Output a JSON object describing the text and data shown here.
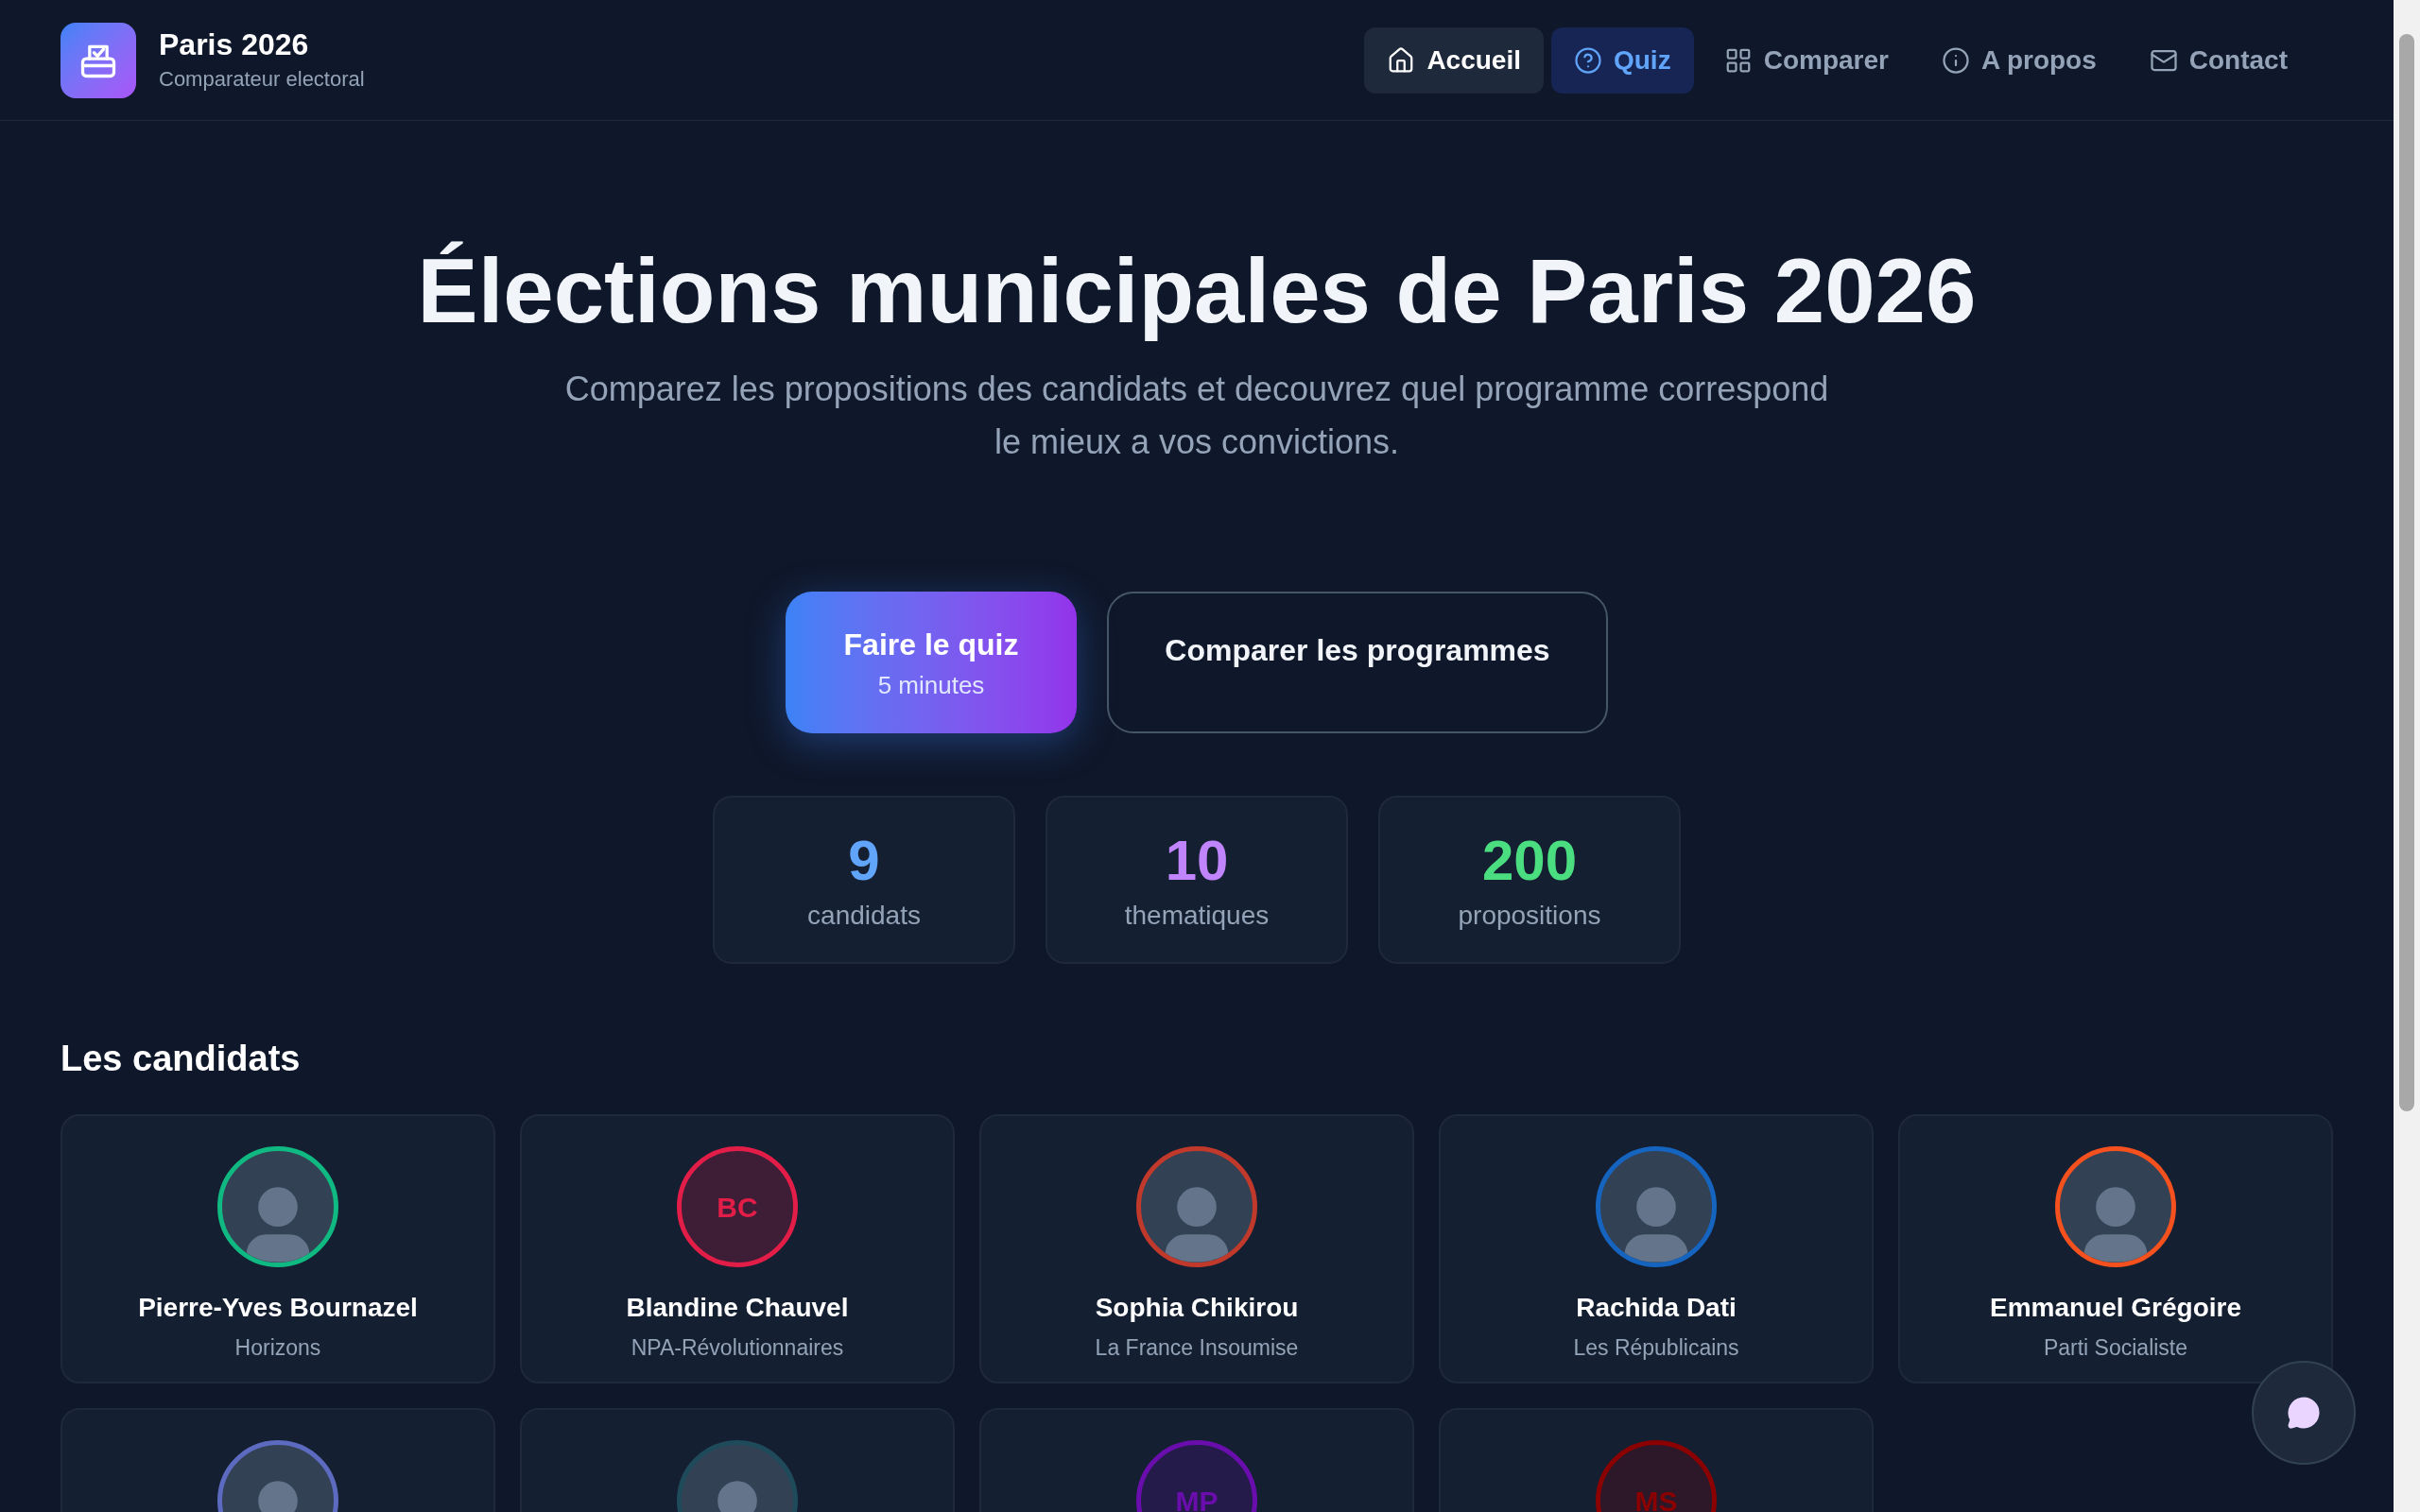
{
  "brand": {
    "title": "Paris 2026",
    "subtitle": "Comparateur electoral"
  },
  "nav": [
    {
      "label": "Accueil",
      "selected": true,
      "hovered": false
    },
    {
      "label": "Quiz",
      "selected": false,
      "hovered": true
    },
    {
      "label": "Comparer",
      "selected": false,
      "hovered": false
    },
    {
      "label": "A propos",
      "selected": false,
      "hovered": false
    },
    {
      "label": "Contact",
      "selected": false,
      "hovered": false
    }
  ],
  "hero": {
    "title": "Élections municipales de Paris 2026",
    "subtitle": "Comparez les propositions des candidats et decouvrez quel programme correspond le mieux a vos convictions."
  },
  "actions": [
    {
      "kind": "primary",
      "label": "Faire le quiz",
      "sublabel": "5 minutes"
    },
    {
      "kind": "outline",
      "label": "Comparer les programmes"
    }
  ],
  "stats": [
    {
      "value": "9",
      "label": "candidats",
      "color": "#60a5fa"
    },
    {
      "value": "10",
      "label": "thematiques",
      "color": "#c084fc"
    },
    {
      "value": "200",
      "label": "propositions",
      "color": "#4ade80"
    }
  ],
  "candidates_heading": "Les candidats",
  "candidates": [
    {
      "kind": "photo",
      "name": "Pierre-Yves Bournazel",
      "party": "Horizons",
      "color": "#10b981"
    },
    {
      "kind": "initials",
      "initials": "BC",
      "name": "Blandine Chauvel",
      "party": "NPA-Révolutionnaires",
      "color": "#e11d48"
    },
    {
      "kind": "photo",
      "name": "Sophia Chikirou",
      "party": "La France Insoumise",
      "color": "#c0392b"
    },
    {
      "kind": "photo",
      "name": "Rachida Dati",
      "party": "Les Républicains",
      "color": "#1565c0"
    },
    {
      "kind": "photo",
      "name": "Emmanuel Grégoire",
      "party": "Parti Socialiste",
      "color": "#f4511e"
    },
    {
      "kind": "photo",
      "color": "#5c6bc0"
    },
    {
      "kind": "photo",
      "color": "#1e4a5a"
    },
    {
      "kind": "initials",
      "initials": "MP",
      "color": "#6a0dad"
    },
    {
      "kind": "initials",
      "initials": "MS",
      "color": "#8b0000"
    }
  ]
}
